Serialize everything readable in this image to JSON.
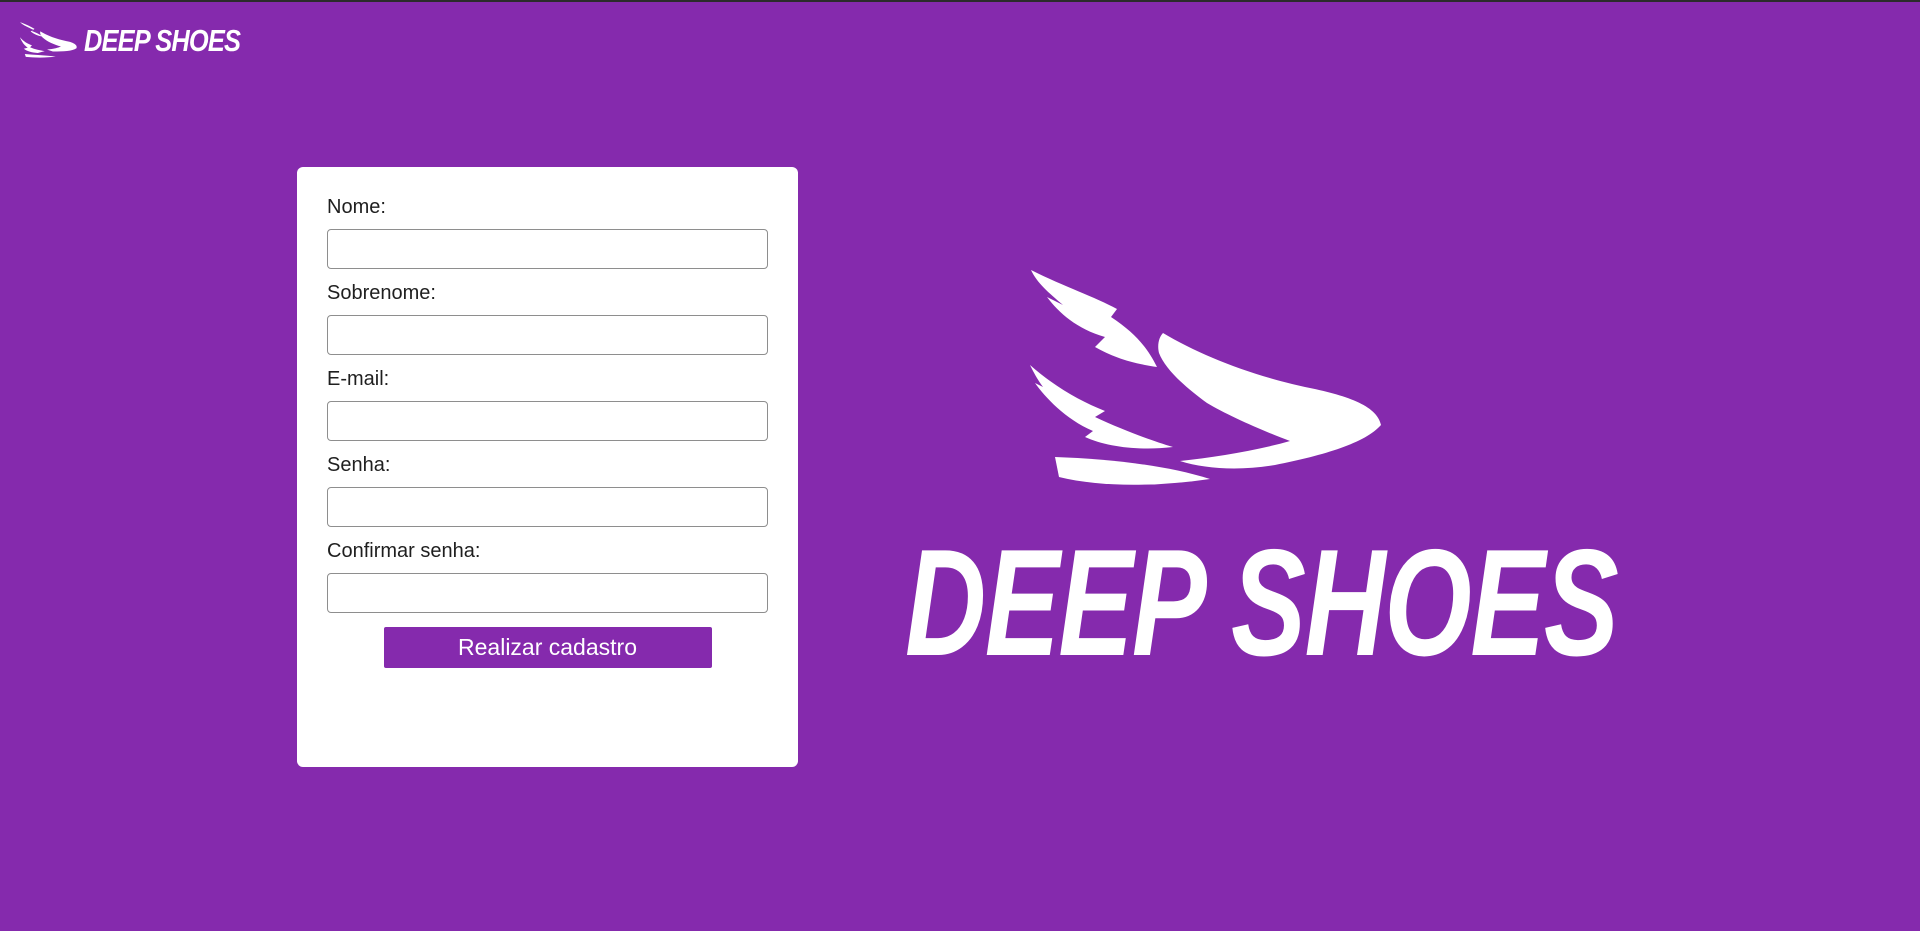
{
  "brand": {
    "name": "DEEP SHOES",
    "logo_icon": "winged-shoe-icon",
    "background_color": "#852aad",
    "text_color": "#ffffff"
  },
  "form": {
    "fields": [
      {
        "label": "Nome:",
        "value": "",
        "type": "text"
      },
      {
        "label": "Sobrenome:",
        "value": "",
        "type": "text"
      },
      {
        "label": "E-mail:",
        "value": "",
        "type": "email"
      },
      {
        "label": "Senha:",
        "value": "",
        "type": "password"
      },
      {
        "label": "Confirmar senha:",
        "value": "",
        "type": "password"
      }
    ],
    "submit_label": "Realizar cadastro"
  }
}
